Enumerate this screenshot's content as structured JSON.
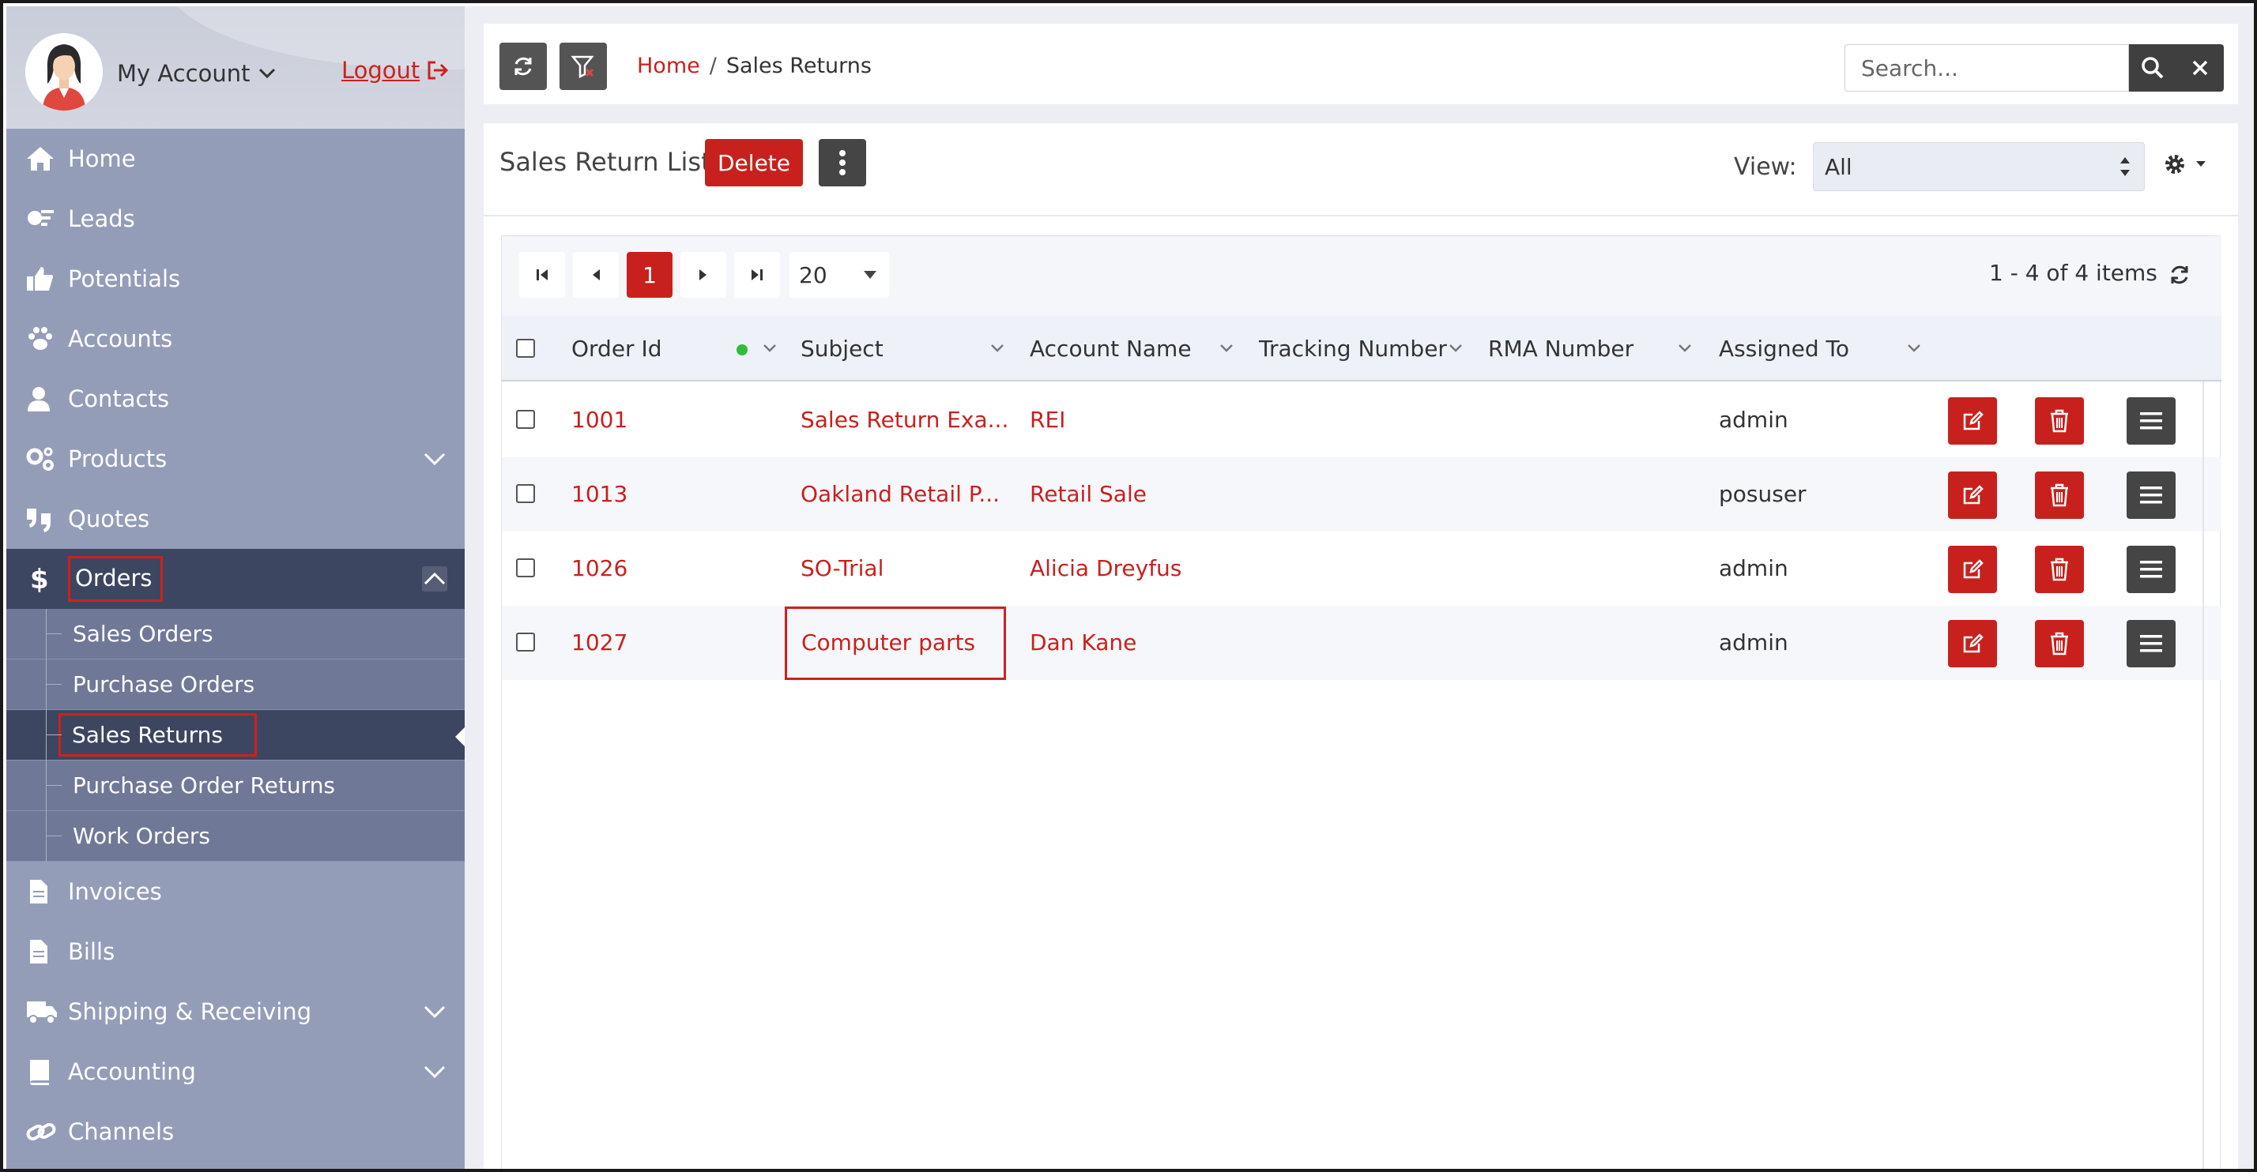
{
  "sidebar": {
    "account_label": "My Account",
    "logout_label": "Logout",
    "items": [
      {
        "label": "Home",
        "icon": "home-icon"
      },
      {
        "label": "Leads",
        "icon": "leads-icon"
      },
      {
        "label": "Potentials",
        "icon": "thumbs-up-icon"
      },
      {
        "label": "Accounts",
        "icon": "paw-icon"
      },
      {
        "label": "Contacts",
        "icon": "user-icon"
      },
      {
        "label": "Products",
        "icon": "gears-icon"
      },
      {
        "label": "Quotes",
        "icon": "quote-icon"
      },
      {
        "label": "Orders",
        "icon": "dollar-icon"
      },
      {
        "label": "Invoices",
        "icon": "document-icon"
      },
      {
        "label": "Bills",
        "icon": "document-icon"
      },
      {
        "label": "Shipping & Receiving",
        "icon": "truck-icon"
      },
      {
        "label": "Accounting",
        "icon": "book-icon"
      },
      {
        "label": "Channels",
        "icon": "link-icon"
      }
    ],
    "orders_sub": [
      "Sales Orders",
      "Purchase Orders",
      "Sales Returns",
      "Purchase Order Returns",
      "Work Orders"
    ]
  },
  "topbar": {
    "breadcrumb_home": "Home",
    "breadcrumb_sep": "/",
    "breadcrumb_current": "Sales Returns",
    "search_placeholder": "Search..."
  },
  "panel": {
    "title": "Sales Return List",
    "delete_label": "Delete",
    "view_label": "View:",
    "view_value": "All"
  },
  "pager": {
    "current_page": "1",
    "page_size": "20",
    "items_info": "1 - 4 of 4 items"
  },
  "table": {
    "columns": [
      "Order Id",
      "Subject",
      "Account Name",
      "Tracking Number",
      "RMA Number",
      "Assigned To"
    ],
    "rows": [
      {
        "order_id": "1001",
        "subject": "Sales Return Exa...",
        "account": "REI",
        "tracking": "",
        "rma": "",
        "assigned": "admin"
      },
      {
        "order_id": "1013",
        "subject": "Oakland Retail P...",
        "account": "Retail Sale",
        "tracking": "",
        "rma": "",
        "assigned": "posuser"
      },
      {
        "order_id": "1026",
        "subject": "SO-Trial",
        "account": "Alicia Dreyfus",
        "tracking": "",
        "rma": "",
        "assigned": "admin"
      },
      {
        "order_id": "1027",
        "subject": "Computer parts",
        "account": "Dan Kane",
        "tracking": "",
        "rma": "",
        "assigned": "admin"
      }
    ]
  },
  "colors": {
    "accent": "#c8211d",
    "sidebar": "#949db8",
    "sidebar_active": "#3d4660",
    "status_dot": "#2ebd3a"
  }
}
